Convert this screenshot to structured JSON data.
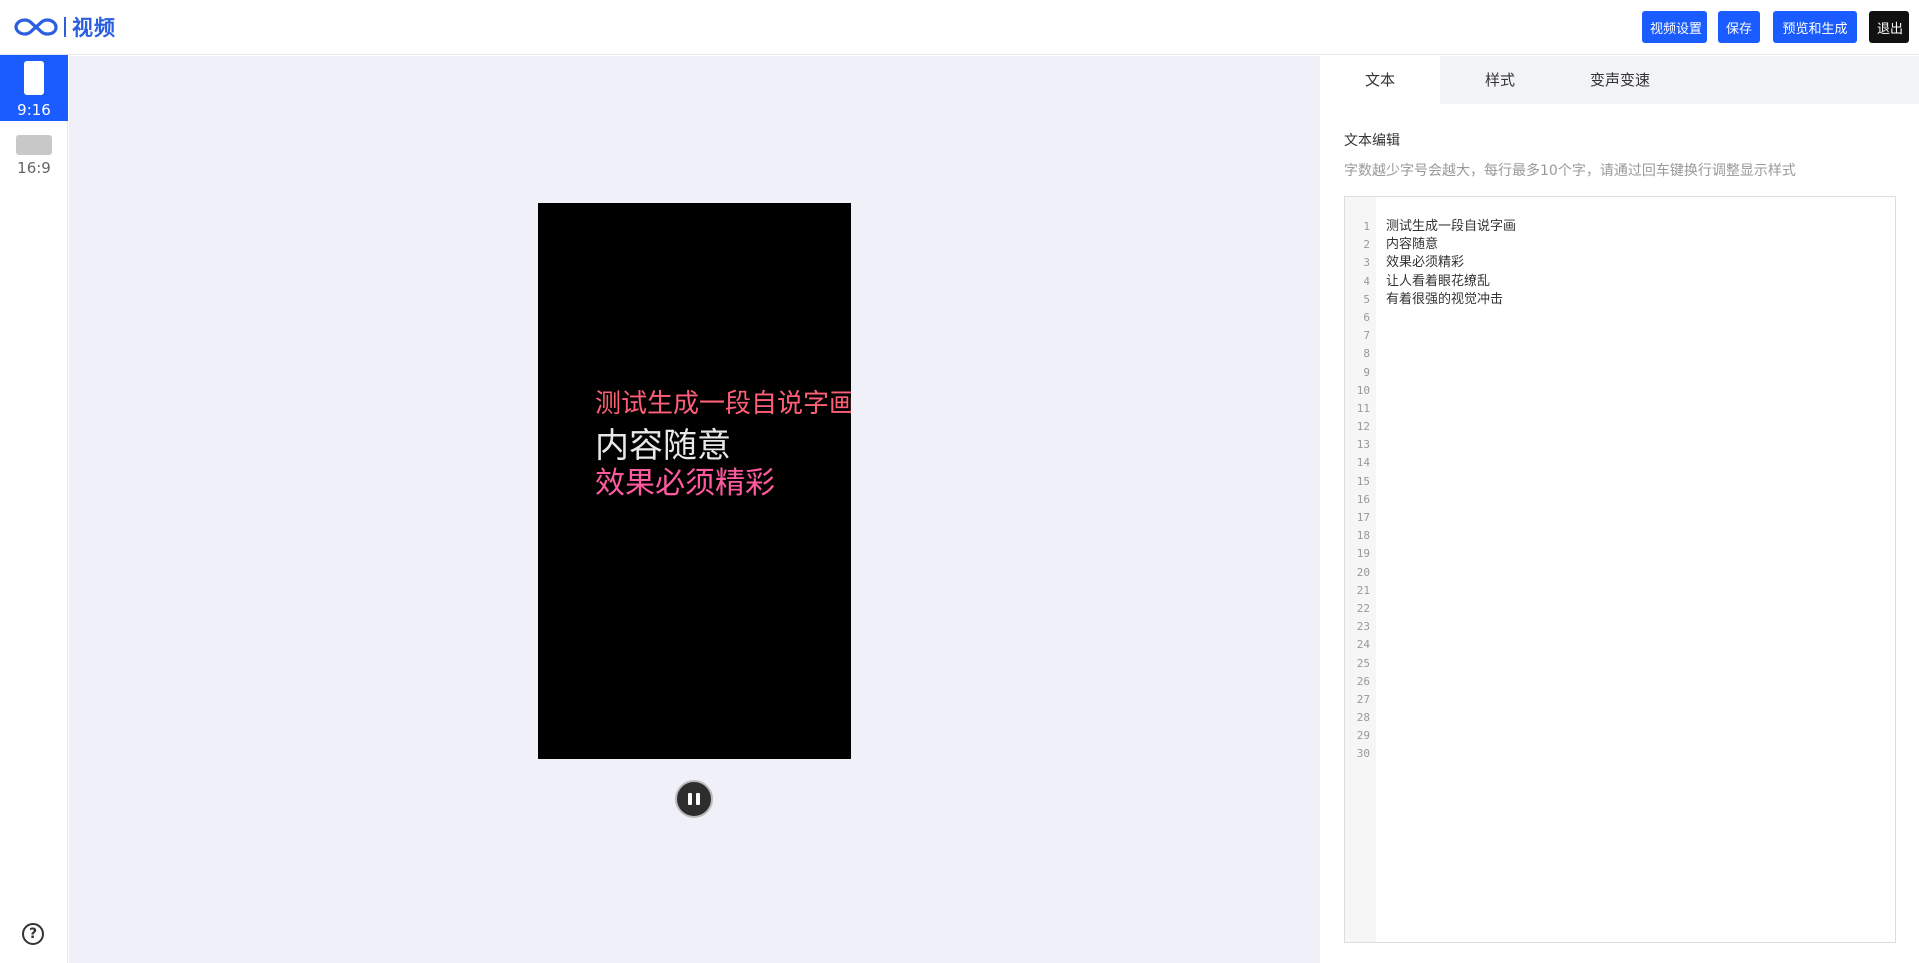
{
  "header": {
    "logo_text": "视频",
    "buttons": {
      "video_settings": "视频设置",
      "save": "保存",
      "preview_generate": "预览和生成",
      "logout": "退出"
    }
  },
  "sidebar": {
    "ratios": [
      {
        "label": "9:16",
        "active": true
      },
      {
        "label": "16:9",
        "active": false
      }
    ],
    "help_icon": "?"
  },
  "preview": {
    "lines": [
      "测试生成一段自说字画",
      "内容随意",
      "效果必须精彩"
    ]
  },
  "panel": {
    "tabs": [
      {
        "label": "文本",
        "active": true
      },
      {
        "label": "样式",
        "active": false
      },
      {
        "label": "变声变速",
        "active": false
      }
    ],
    "section_title": "文本编辑",
    "hint": "字数越少字号会越大，每行最多10个字，请通过回车键换行调整显示样式",
    "editor": {
      "line_numbers": [
        "1",
        "2",
        "3",
        "4",
        "5",
        "6",
        "7",
        "8",
        "9",
        "10",
        "11",
        "12",
        "13",
        "14",
        "15",
        "16",
        "17",
        "18",
        "19",
        "20",
        "21",
        "22",
        "23",
        "24",
        "25",
        "26",
        "27",
        "28",
        "29",
        "30"
      ],
      "lines": [
        "测试生成一段自说字画",
        "内容随意",
        "效果必须精彩",
        "让人看着眼花缭乱",
        "有着很强的视觉冲击"
      ]
    }
  },
  "colors": {
    "accent": "#1a5cff",
    "stage_bg": "#eff0f8"
  }
}
